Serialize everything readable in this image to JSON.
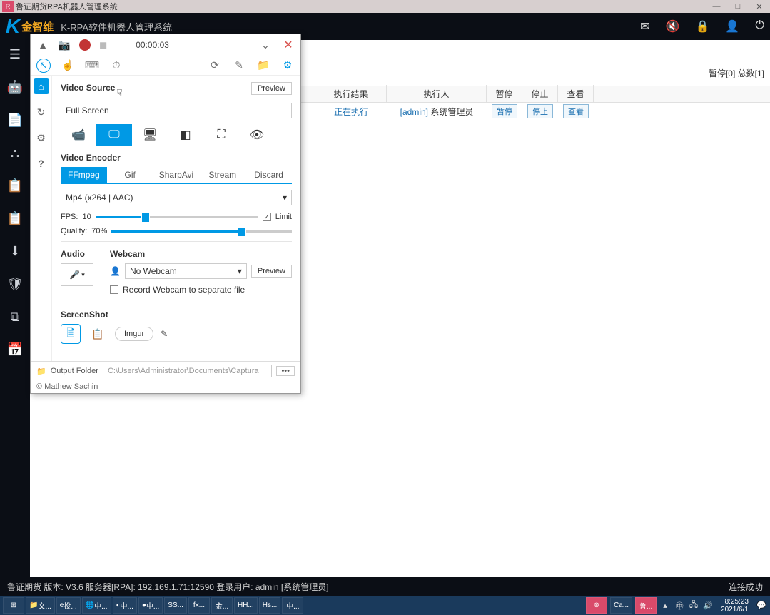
{
  "titlebar": {
    "title": "鲁证期货RPA机器人管理系统"
  },
  "header": {
    "logo_text": "金智维",
    "logo_sub": "K-RPA软件机器人管理系统"
  },
  "stats": {
    "paused": "暂停[0]",
    "total": "总数[1]"
  },
  "table": {
    "headers": {
      "result": "执行结果",
      "executor": "执行人",
      "pause": "暂停",
      "stop": "停止",
      "view": "查看"
    },
    "row": {
      "result": "正在执行",
      "executor_user": "[admin]",
      "executor_role": "系统管理员",
      "pause_btn": "暂停",
      "stop_btn": "停止",
      "view_btn": "查看"
    }
  },
  "captura": {
    "timer": "00:00:03",
    "video_source": {
      "title": "Video Source",
      "preview": "Preview",
      "value": "Full Screen"
    },
    "encoder": {
      "title": "Video Encoder",
      "tabs": [
        "FFmpeg",
        "Gif",
        "SharpAvi",
        "Stream",
        "Discard"
      ],
      "format": "Mp4 (x264 | AAC)",
      "fps_label": "FPS:",
      "fps_value": "10",
      "limit": "Limit",
      "quality_label": "Quality:",
      "quality_value": "70%"
    },
    "audio": {
      "title": "Audio"
    },
    "webcam": {
      "title": "Webcam",
      "value": "No Webcam",
      "preview": "Preview",
      "separate": "Record Webcam to separate file"
    },
    "screenshot": {
      "title": "ScreenShot",
      "imgur": "Imgur"
    },
    "footer": {
      "output_label": "Output Folder",
      "output_path": "C:\\Users\\Administrator\\Documents\\Captura",
      "copyright": "© Mathew Sachin"
    }
  },
  "status": {
    "text": "鲁证期货  版本: V3.6  服务器[RPA]: 192.169.1.71:12590  登录用户: admin [系统管理员]",
    "conn": "连接成功"
  },
  "taskbar": {
    "items": [
      "文...",
      "投...",
      "中...",
      "中...",
      "中...",
      "SS...",
      "fx...",
      "金...",
      "H...",
      "Hs...",
      "中..."
    ],
    "tray_text": "Ca...",
    "tray_text2": "鲁...",
    "time": "8:25:23",
    "date": "2021/6/1"
  }
}
